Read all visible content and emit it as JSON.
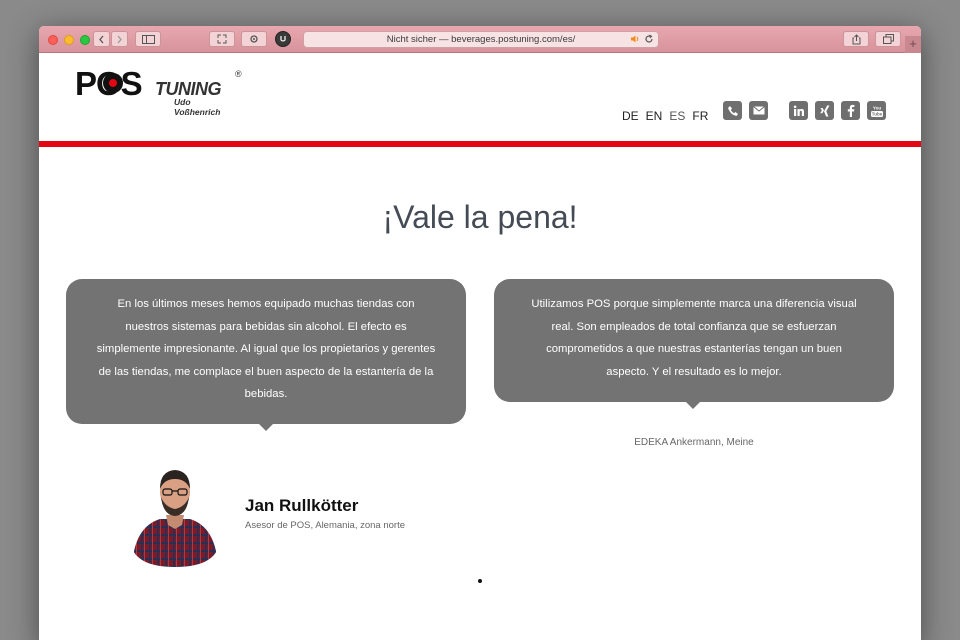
{
  "browser": {
    "url": "Nicht sicher — beverages.postuning.com/es/"
  },
  "logo": {
    "brand_pos": "POS",
    "brand_tuning": "TUNING",
    "registered": "®",
    "owner": "Udo Voßhenrich"
  },
  "languages": [
    {
      "code": "DE"
    },
    {
      "code": "EN"
    },
    {
      "code": "ES",
      "active": true
    },
    {
      "code": "FR"
    }
  ],
  "contact_icons": [
    "phone-icon",
    "mail-icon"
  ],
  "social_icons": [
    "linkedin-icon",
    "xing-icon",
    "facebook-icon",
    "youtube-icon"
  ],
  "headline": "¡Vale la pena!",
  "testimonials": [
    {
      "text": "En los últimos meses hemos equipado muchas tiendas con nuestros sistemas para bebidas sin alcohol. El efecto es simplemente impresionante. Al igual que los propietarios y gerentes de las tiendas, me complace el buen aspecto de la estantería de la bebidas."
    },
    {
      "text": "Utilizamos POS porque simplemente marca una diferencia visual real. Son empleados de total confianza que se esfuerzan comprometidos a que nuestras estanterías tengan un buen aspecto. Y el resultado es lo mejor.",
      "attribution": "EDEKA Ankermann, Meine"
    }
  ],
  "person": {
    "name": "Jan Rullkötter",
    "role": "Asesor de POS, Alemania, zona norte"
  },
  "colors": {
    "accent_red": "#e30613",
    "bubble_gray": "#737373",
    "icon_gray": "#6f6f6f",
    "toolbar_pink": "#e8a7ae"
  }
}
